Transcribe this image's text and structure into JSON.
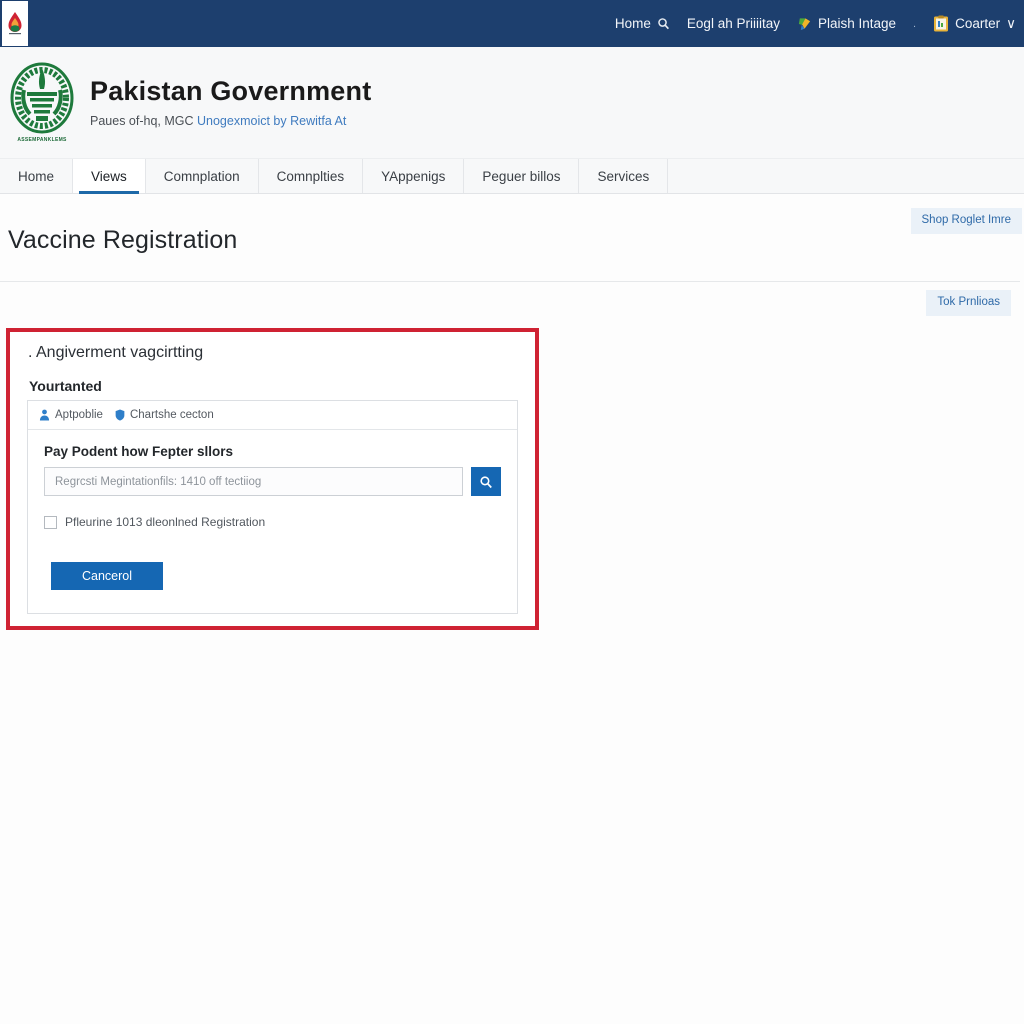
{
  "topbar": {
    "favicon_icon": "droplet-flame-icon",
    "background_color": "#1d3f6e",
    "nav_items": [
      {
        "label": "Home",
        "icon": "search-icon"
      },
      {
        "label": "Eogl ah Priiiitay",
        "icon": ""
      },
      {
        "label": "Plaish Intage",
        "icon": "ribbon-icon"
      },
      {
        "label": "Coarter",
        "icon": "clipboard-icon",
        "caret": "∨"
      }
    ],
    "separator_dot": "."
  },
  "brand": {
    "emblem_icon": "pakistan-government-emblem-icon",
    "emblem_caption": "ASSEMPANKLEMS",
    "title": "Pakistan Government",
    "subtitle_plain": "Paues of-hq, MGC",
    "subtitle_link": "Unogexmoict by Rewitfa At"
  },
  "tabs": [
    {
      "label": "Home",
      "active": false
    },
    {
      "label": "Views",
      "active": true
    },
    {
      "label": "Comnplation",
      "active": false
    },
    {
      "label": "Comnplties",
      "active": false
    },
    {
      "label": "YAppenigs",
      "active": false
    },
    {
      "label": "Peguer billos",
      "active": false
    },
    {
      "label": "Services",
      "active": false
    }
  ],
  "page": {
    "title": "Vaccine Registration",
    "top_action_label": "Shop Roglet Imre",
    "second_action_label": "Tok Prnlioas"
  },
  "card": {
    "border_color": "#cf2233",
    "heading": ". Angiverment vagcirtting",
    "subheading": "Yourtanted",
    "panel_tabs": [
      {
        "label": "Aptpoblie",
        "icon": "person-icon"
      },
      {
        "label": "Chartshe cecton",
        "icon": "shield-icon"
      }
    ],
    "field_label": "Pay Podent how Fepter sllors",
    "input_value": "",
    "input_placeholder": "Regrcsti Megintationfils: 1410 off tectiiog",
    "search_icon": "search-icon",
    "checkbox_label": "Pfleurine 1013 dleonlned Registration",
    "checkbox_checked": false,
    "primary_button_label": "Cancerol",
    "accent_color": "#1567b3"
  }
}
